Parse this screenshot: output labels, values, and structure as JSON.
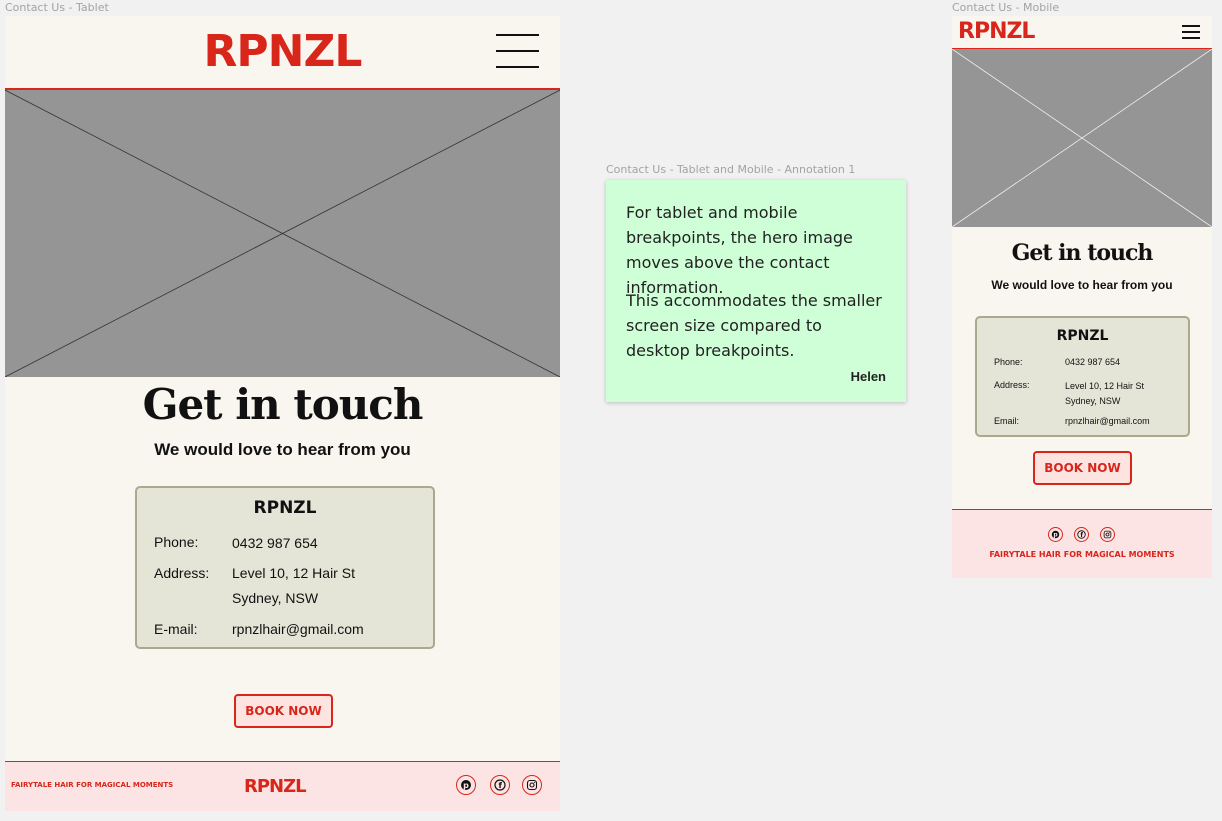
{
  "tablet": {
    "frame_label": "Contact Us - Tablet",
    "logo": "RPNZL",
    "heading": "Get in touch",
    "subheading": "We would love to hear from you",
    "card": {
      "logo": "RPNZL",
      "phone_label": "Phone:",
      "phone": "0432 987 654",
      "address_label": "Address:",
      "address_line1": "Level 10, 12 Hair St",
      "address_line2": "Sydney, NSW",
      "email_label": "E-mail:",
      "email": "rpnzlhair@gmail.com"
    },
    "book_label": "BOOK NOW",
    "footer": {
      "tagline": "FAIRYTALE HAIR FOR MAGICAL MOMENTS",
      "logo": "RPNZL",
      "social_icons": [
        "pinterest-icon",
        "facebook-icon",
        "instagram-icon"
      ]
    }
  },
  "annotation": {
    "frame_label": "Contact Us - Tablet and Mobile - Annotation 1",
    "paragraph1": "For tablet and mobile breakpoints, the hero image moves above the contact information.",
    "paragraph2": "This accommodates the smaller screen size compared to desktop breakpoints.",
    "author": "Helen"
  },
  "mobile": {
    "frame_label": "Contact Us - Mobile",
    "logo": "RPNZL",
    "heading": "Get in touch",
    "subheading": "We would love to hear from you",
    "card": {
      "logo": "RPNZL",
      "phone_label": "Phone:",
      "phone": "0432 987 654",
      "address_label": "Address:",
      "address_line1": "Level 10, 12 Hair St",
      "address_line2": "Sydney, NSW",
      "email_label": "Email:",
      "email": "rpnzlhair@gmail.com"
    },
    "book_label": "BOOK NOW",
    "footer": {
      "tagline": "FAIRYTALE HAIR FOR MAGICAL MOMENTS",
      "social_icons": [
        "pinterest-icon",
        "facebook-icon",
        "instagram-icon"
      ]
    }
  },
  "colors": {
    "brand_red": "#d8261b",
    "page_bg": "#f9f6ef",
    "card_bg": "#e4e5d7",
    "footer_bg": "#fde4e4",
    "note_bg": "#cfffd7",
    "placeholder": "#959595"
  }
}
